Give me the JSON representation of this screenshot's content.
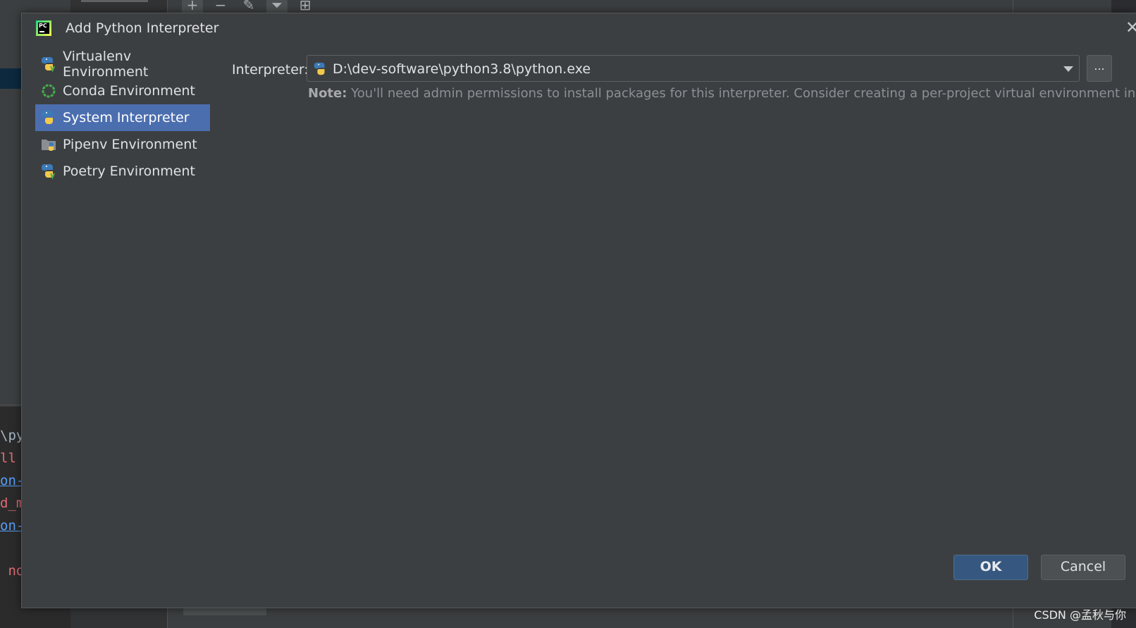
{
  "background": {
    "code_lines": [
      "\\py",
      "ll",
      "on-",
      "d_m",
      "on-",
      " no"
    ],
    "toolbar": [
      "+",
      "−",
      "✎",
      "⏷",
      "⊞"
    ],
    "watermark": "CSDN @孟秋与你"
  },
  "dialog": {
    "title": "Add Python Interpreter",
    "close": "✕",
    "environments": [
      {
        "label": "Virtualenv Environment",
        "icon": "virtualenv-icon"
      },
      {
        "label": "Conda Environment",
        "icon": "conda-icon"
      },
      {
        "label": "System Interpreter",
        "icon": "python-icon",
        "selected": true
      },
      {
        "label": "Pipenv Environment",
        "icon": "pipenv-icon"
      },
      {
        "label": "Poetry Environment",
        "icon": "poetry-icon"
      }
    ],
    "interpreter": {
      "label": "Interpreter:",
      "value": "D:\\dev-software\\python3.8\\python.exe",
      "browse": "..."
    },
    "note": {
      "prefix": "Note:",
      "text": " You'll need admin permissions to install packages for this interpreter. Consider creating a per-project virtual environment instead."
    },
    "buttons": {
      "ok": "OK",
      "cancel": "Cancel"
    }
  },
  "colors": {
    "dialog_bg": "#3c3f41",
    "selection": "#4b6eaf",
    "ok_button": "#365880",
    "text": "#dfe1e5",
    "note_text": "#8c8f94"
  }
}
